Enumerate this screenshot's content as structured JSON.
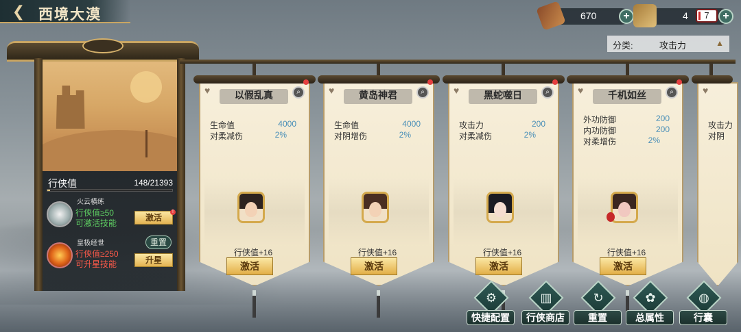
{
  "header": {
    "title": "西境大漠",
    "back_icon": "back-arrow-icon"
  },
  "resources": [
    {
      "icon": "scroll-token-icon",
      "value": "670"
    },
    {
      "icon": "book-icon",
      "value": "4",
      "badge": "7"
    }
  ],
  "category": {
    "label": "分类:",
    "value": "攻击力"
  },
  "left_panel": {
    "xiaxia_label": "行侠值",
    "xiaxia_value": "148/21393",
    "xiaxia_progress": 0.007,
    "skills": [
      {
        "name": "火云横练",
        "req_line1": "行侠值≥50",
        "req_line2": "可激活技能",
        "button": "激活",
        "badge": "!"
      },
      {
        "name": "皇极经世",
        "req_line1": "行侠值≥250",
        "req_line2": "可升星技能",
        "button": "升星"
      }
    ],
    "reset_label": "重置"
  },
  "cards": [
    {
      "name": "以假乱真",
      "stats": [
        {
          "label": "生命值",
          "value": "4000"
        },
        {
          "label": "对柔减伤",
          "value": "2%"
        }
      ],
      "bonus": "行侠值+16",
      "button": "激活"
    },
    {
      "name": "黄岛神君",
      "stats": [
        {
          "label": "生命值",
          "value": "4000"
        },
        {
          "label": "对阴增伤",
          "value": "2%"
        }
      ],
      "bonus": "行侠值+16",
      "button": "激活"
    },
    {
      "name": "黑蛇噬日",
      "stats": [
        {
          "label": "攻击力",
          "value": "200"
        },
        {
          "label": "对柔减伤",
          "value": "2%"
        }
      ],
      "bonus": "行侠值+16",
      "button": "激活"
    },
    {
      "name": "千机如丝",
      "stats": [
        {
          "label": "外功防御",
          "value": "200"
        },
        {
          "label": "内功防御",
          "value": "200"
        },
        {
          "label": "对柔增伤",
          "value": "2%"
        }
      ],
      "bonus": "行侠值+16",
      "button": "激活"
    },
    {
      "partial_stats": [
        {
          "label": "攻击力"
        },
        {
          "label": "对阴"
        }
      ]
    }
  ],
  "bottom_nav": [
    {
      "label": "快捷配置",
      "icon": "quick-config-icon"
    },
    {
      "label": "行侠商店",
      "icon": "shop-icon"
    },
    {
      "label": "重置",
      "icon": "reset-icon"
    },
    {
      "label": "总属性",
      "icon": "total-attributes-icon"
    },
    {
      "label": "行囊",
      "icon": "bag-icon"
    }
  ],
  "colors": {
    "gold_button": "#e3b352",
    "stat_value": "#4a8fb8",
    "req_ok": "#5fd063",
    "req_fail": "#ff5a4a"
  }
}
